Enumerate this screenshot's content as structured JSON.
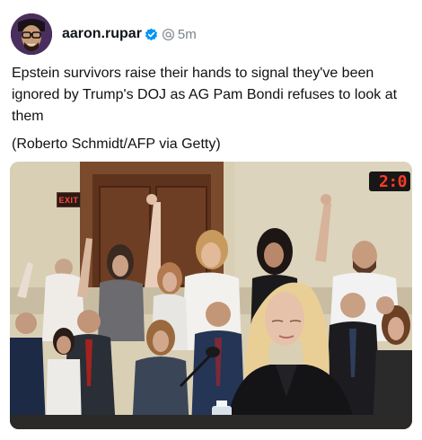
{
  "post": {
    "username": "aaron.rupar",
    "time": "5m",
    "text": "Epstein survivors raise their hands to signal they've been ignored by Trump's DOJ as AG Pam Bondi refuses to look at them",
    "caption": "(Roberto Schmidt/AFP via Getty)"
  },
  "photo": {
    "exit_sign": "EXIT",
    "clock": "2:0"
  },
  "icons": {
    "verified": "verified-badge-icon",
    "threads": "threads-logo-icon"
  },
  "colors": {
    "verified_blue": "#0095f6",
    "meta_gray": "#7b8289",
    "text": "#111111"
  }
}
